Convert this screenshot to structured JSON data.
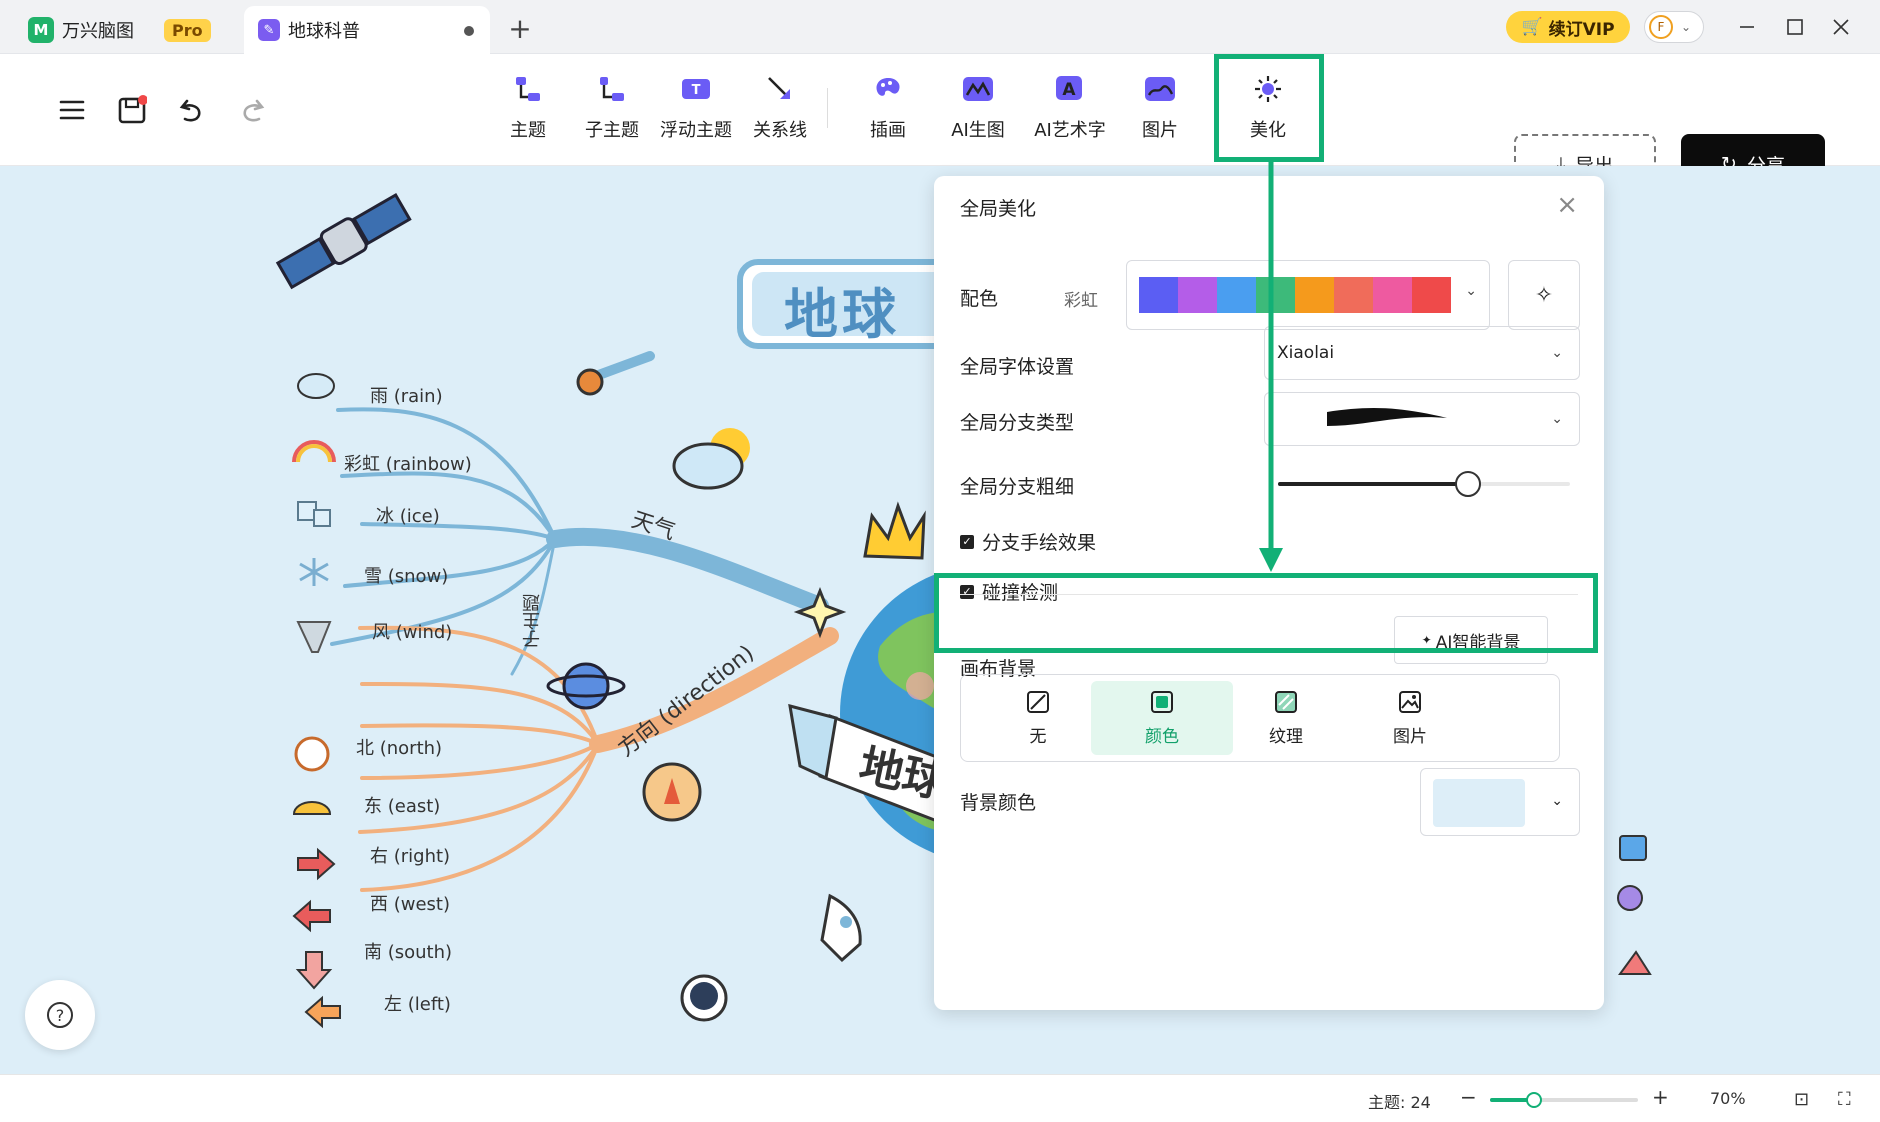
{
  "tabs": {
    "app_name": "万兴脑图",
    "pro_badge": "Pro",
    "doc_title": "地球科普",
    "new_tab": "+"
  },
  "topright": {
    "vip_label": "续订VIP",
    "avatar_letter": "F"
  },
  "toolbar": {
    "tools": [
      "主题",
      "子主题",
      "浮动主题",
      "关系线",
      "插画",
      "AI生图",
      "AI艺术字",
      "图片",
      "美化"
    ],
    "export_label": "导出",
    "share_label": "分享"
  },
  "mindmap": {
    "central": "地球",
    "banner": "地球",
    "branch_weather": "天气",
    "branch_direction": "方向 (direction)",
    "subtopic_vertical": "子主题",
    "weather_items": [
      "雨 (rain)",
      "彩虹 (rainbow)",
      "冰 (ice)",
      "雪 (snow)",
      "风 (wind)"
    ],
    "direction_items": [
      "北 (north)",
      "东 (east)",
      "右 (right)",
      "西 (west)",
      "南 (south)",
      "左 (left)"
    ]
  },
  "panel": {
    "title": "全局美化",
    "color_label": "配色",
    "color_scheme": "彩虹",
    "swatches": [
      "#5b5ef3",
      "#b45de8",
      "#4a9ef0",
      "#3dba7a",
      "#f59a1c",
      "#f06c5a",
      "#ee5aa0",
      "#ef4a4a"
    ],
    "font_label": "全局字体设置",
    "font_value": "Xiaolai",
    "branch_type_label": "全局分支类型",
    "branch_width_label": "全局分支粗细",
    "branch_width_level": 0.65,
    "handdrawn_label": "分支手绘效果",
    "handdrawn_checked": true,
    "collision_label": "碰撞检测",
    "collision_checked": true,
    "canvas_bg_label": "画布背景",
    "ai_bg_label": "AI智能背景",
    "bg_options": [
      "无",
      "颜色",
      "纹理",
      "图片"
    ],
    "bg_active": "颜色",
    "bg_color_label": "背景颜色",
    "bg_color": "#ddeef8"
  },
  "status": {
    "topic_count": "主题: 24",
    "zoom_minus": "−",
    "zoom_plus": "+",
    "zoom_level": "70%",
    "zoom_fraction": 0.3
  },
  "colors": {
    "accent": "#12b076",
    "weather_branch": "#7db6d8",
    "direction_branch": "#f2b07e"
  }
}
